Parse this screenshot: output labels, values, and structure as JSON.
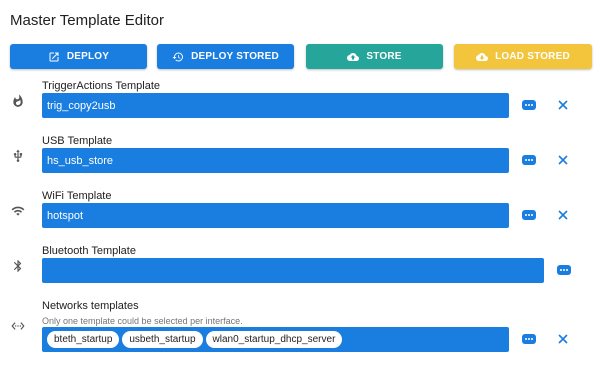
{
  "page": {
    "title": "Master Template Editor"
  },
  "actions": {
    "deploy": "DEPLOY",
    "deploy_stored": "DEPLOY STORED",
    "store": "STORE",
    "load_stored": "LOAD STORED"
  },
  "templates": {
    "trigger": {
      "label": "TriggerActions Template",
      "value": "trig_copy2usb",
      "icon": "fire-icon"
    },
    "usb": {
      "label": "USB Template",
      "value": "hs_usb_store",
      "icon": "usb-icon"
    },
    "wifi": {
      "label": "WiFi Template",
      "value": "hotspot",
      "icon": "wifi-icon"
    },
    "bluetooth": {
      "label": "Bluetooth Template",
      "value": "",
      "icon": "bluetooth-icon"
    },
    "networks": {
      "label": "Networks templates",
      "hint": "Only one template could be selected per interface.",
      "icon": "network-icon",
      "chips": [
        "bteth_startup",
        "usbeth_startup",
        "wlan0_startup_dhcp_server"
      ]
    }
  },
  "colors": {
    "primary": "#1a7de0",
    "store": "#26a69a",
    "load": "#f2c53d"
  }
}
